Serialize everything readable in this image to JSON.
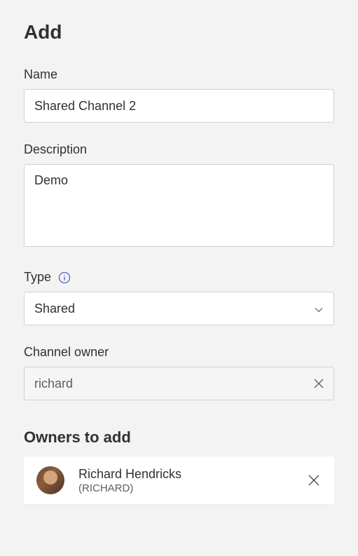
{
  "page": {
    "title": "Add"
  },
  "fields": {
    "name": {
      "label": "Name",
      "value": "Shared Channel 2"
    },
    "description": {
      "label": "Description",
      "value": "Demo"
    },
    "type": {
      "label": "Type",
      "value": "Shared"
    },
    "channelOwner": {
      "label": "Channel owner",
      "value": "richard"
    }
  },
  "ownersSection": {
    "title": "Owners to add",
    "owners": [
      {
        "name": "Richard Hendricks",
        "username": "(RICHARD)"
      }
    ]
  }
}
